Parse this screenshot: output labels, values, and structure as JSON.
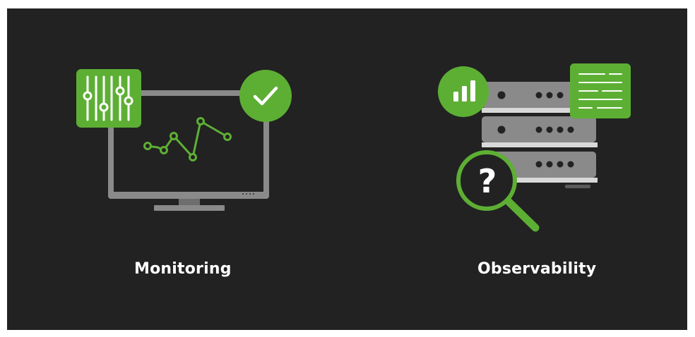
{
  "colors": {
    "background": "#222222",
    "accent": "#5daf34",
    "device_gray": "#8a8a8a",
    "device_dark": "#5a5a5a",
    "text": "#ffffff"
  },
  "sections": [
    {
      "caption": "Monitoring",
      "icons": [
        "monitor-icon",
        "sliders-icon",
        "checkmark-icon",
        "line-graph-icon"
      ]
    },
    {
      "caption": "Observability",
      "icons": [
        "server-stack-icon",
        "bar-chart-icon",
        "log-document-icon",
        "magnifier-question-icon"
      ],
      "magnifier_symbol": "?"
    }
  ]
}
